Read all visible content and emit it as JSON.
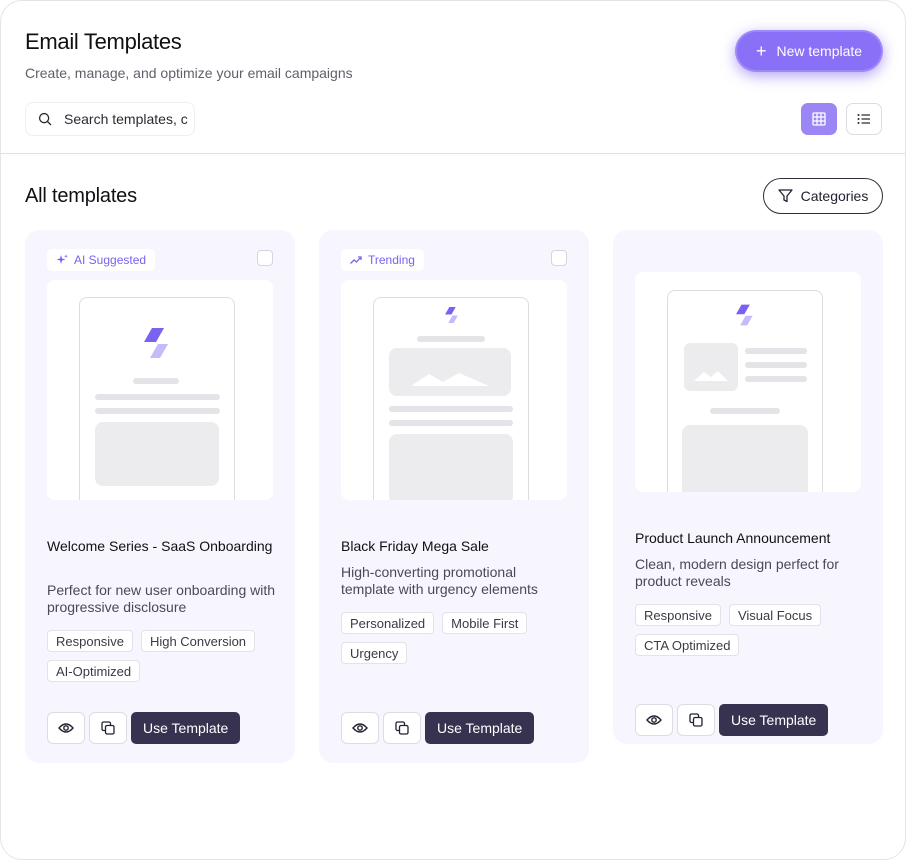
{
  "header": {
    "title": "Email Templates",
    "subtitle": "Create, manage, and optimize your email campaigns",
    "new_button_label": "New template"
  },
  "search": {
    "placeholder": "Search templates, c"
  },
  "section": {
    "title": "All templates",
    "categories_label": "Categories"
  },
  "colors": {
    "accent": "#8a6ff7",
    "primary_button": "#36324f",
    "card_bg": "#f7f6fe"
  },
  "cards": [
    {
      "badge": "AI Suggested",
      "badge_icon": "sparkle-icon",
      "title": "Welcome Series - SaaS Onboarding",
      "description": "Perfect for new user onboarding with progressive disclosure",
      "tags": [
        "Responsive",
        "High Conversion",
        "AI-Optimized"
      ],
      "use_label": "Use Template"
    },
    {
      "badge": "Trending",
      "badge_icon": "trending-up-icon",
      "title": "Black Friday Mega Sale",
      "description": "High-converting promotional template with urgency elements",
      "tags": [
        "Personalized",
        "Mobile First",
        "Urgency"
      ],
      "use_label": "Use Template"
    },
    {
      "badge": "",
      "title": "Product Launch Announcement",
      "description": "Clean, modern design perfect for product reveals",
      "tags": [
        "Responsive",
        "Visual Focus",
        "CTA Optimized"
      ],
      "use_label": "Use Template"
    }
  ]
}
